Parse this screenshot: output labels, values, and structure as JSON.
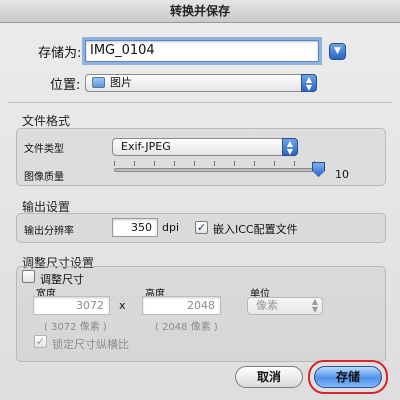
{
  "window": {
    "title": "转换并保存"
  },
  "save_as": {
    "label": "存储为:",
    "value": "IMG_0104"
  },
  "location": {
    "label": "位置:",
    "value": "图片"
  },
  "file_format": {
    "heading": "文件格式",
    "file_type_label": "文件类型",
    "file_type_value": "Exif-JPEG",
    "quality_label": "图像质量",
    "quality_value": "10",
    "quality_max": 10
  },
  "output": {
    "heading": "输出设置",
    "resolution_label": "输出分辨率",
    "resolution_value": "350",
    "resolution_unit": "dpi",
    "embed_icc_label": "嵌入ICC配置文件",
    "embed_icc_checked": true
  },
  "resize": {
    "heading": "调整尺寸设置",
    "resize_label": "调整尺寸",
    "resize_checked": false,
    "width_label": "宽度",
    "width_value": "3072",
    "width_pixels": "( 3072 像素 )",
    "times": "x",
    "height_label": "高度",
    "height_value": "2048",
    "height_pixels": "( 2048 像素 )",
    "unit_label": "单位",
    "unit_value": "像素",
    "lock_label": "锁定尺寸纵横比",
    "lock_checked": true
  },
  "buttons": {
    "cancel": "取消",
    "save": "存储"
  },
  "colors": {
    "accent": "#2b66c8",
    "highlight_ring": "#d8242c"
  }
}
